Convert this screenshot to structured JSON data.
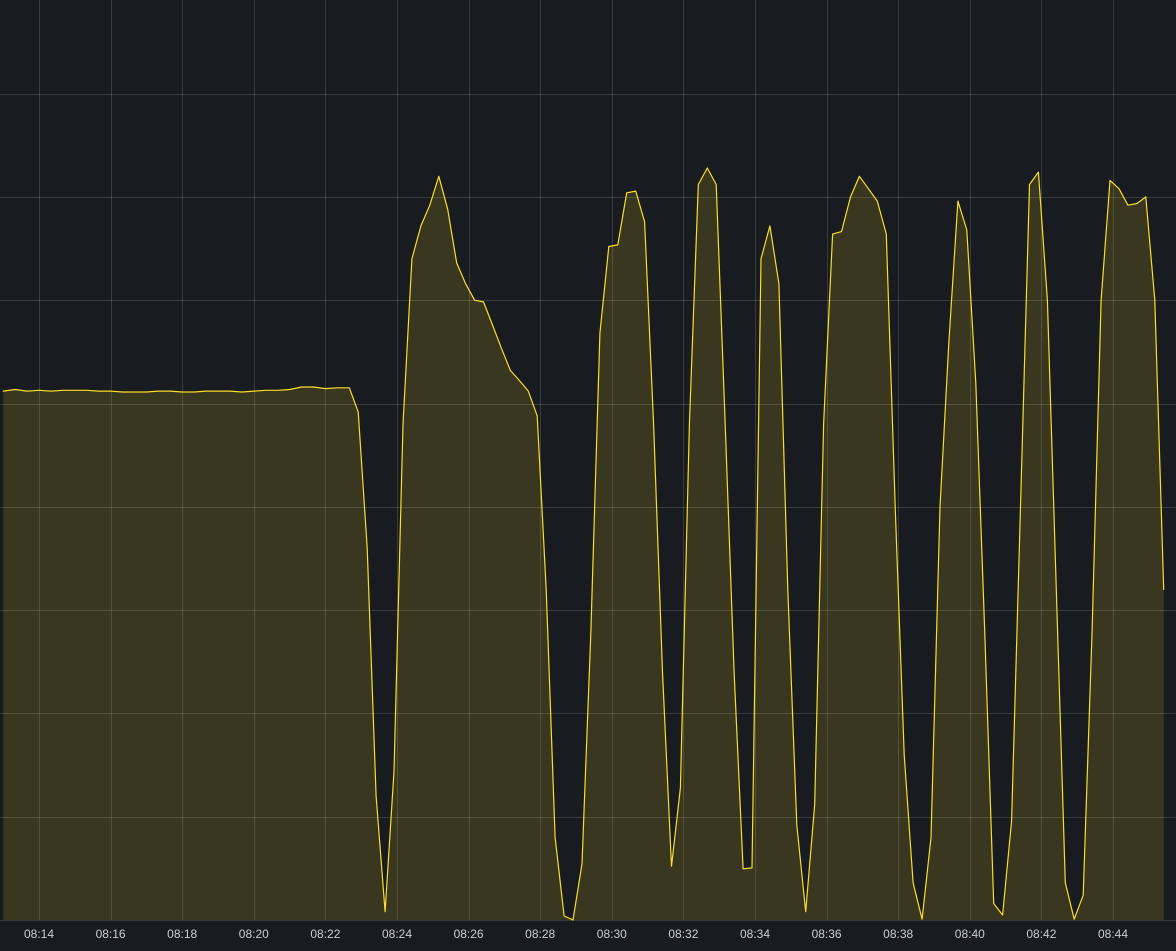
{
  "panel": {
    "background": "#181b1f",
    "series_color": "#fade2a"
  },
  "chart_data": {
    "type": "area",
    "title": "",
    "xlabel": "",
    "ylabel": "",
    "y_axis_visible": false,
    "grid": true,
    "legend": "none",
    "x_ticks": [
      "08:14",
      "08:16",
      "08:18",
      "08:20",
      "08:22",
      "08:24",
      "08:26",
      "08:28",
      "08:30",
      "08:32",
      "08:34",
      "08:36",
      "08:38",
      "08:40",
      "08:42",
      "08:44"
    ],
    "ylim": [
      0,
      100
    ],
    "series": [
      {
        "color": "#fade2a",
        "points": [
          [
            "08:13:00",
            64.0
          ],
          [
            "08:13:20",
            64.2
          ],
          [
            "08:13:40",
            64.0
          ],
          [
            "08:14:00",
            64.1
          ],
          [
            "08:14:20",
            64.0
          ],
          [
            "08:14:40",
            64.1
          ],
          [
            "08:15:00",
            64.1
          ],
          [
            "08:15:20",
            64.1
          ],
          [
            "08:15:40",
            64.0
          ],
          [
            "08:16:00",
            64.0
          ],
          [
            "08:16:20",
            63.9
          ],
          [
            "08:16:40",
            63.9
          ],
          [
            "08:17:00",
            63.9
          ],
          [
            "08:17:20",
            64.0
          ],
          [
            "08:17:40",
            64.0
          ],
          [
            "08:18:00",
            63.9
          ],
          [
            "08:18:20",
            63.9
          ],
          [
            "08:18:40",
            64.0
          ],
          [
            "08:19:00",
            64.0
          ],
          [
            "08:19:20",
            64.0
          ],
          [
            "08:19:40",
            63.9
          ],
          [
            "08:20:00",
            64.0
          ],
          [
            "08:20:20",
            64.1
          ],
          [
            "08:20:40",
            64.1
          ],
          [
            "08:21:00",
            64.2
          ],
          [
            "08:21:20",
            64.5
          ],
          [
            "08:21:40",
            64.5
          ],
          [
            "08:22:00",
            64.3
          ],
          [
            "08:22:20",
            64.4
          ],
          [
            "08:22:40",
            64.4
          ],
          [
            "08:22:55",
            61.5
          ],
          [
            "08:23:10",
            45.0
          ],
          [
            "08:23:25",
            15.0
          ],
          [
            "08:23:40",
            1.0
          ],
          [
            "08:23:55",
            18.0
          ],
          [
            "08:24:10",
            60.0
          ],
          [
            "08:24:25",
            80.0
          ],
          [
            "08:24:40",
            84.0
          ],
          [
            "08:24:55",
            86.5
          ],
          [
            "08:25:10",
            90.0
          ],
          [
            "08:25:25",
            86.0
          ],
          [
            "08:25:40",
            79.5
          ],
          [
            "08:25:55",
            77.0
          ],
          [
            "08:26:10",
            75.0
          ],
          [
            "08:26:25",
            74.8
          ],
          [
            "08:26:40",
            72.0
          ],
          [
            "08:26:55",
            69.2
          ],
          [
            "08:27:10",
            66.5
          ],
          [
            "08:27:25",
            65.3
          ],
          [
            "08:27:40",
            64.0
          ],
          [
            "08:27:55",
            61.0
          ],
          [
            "08:28:10",
            40.0
          ],
          [
            "08:28:25",
            10.0
          ],
          [
            "08:28:40",
            0.5
          ],
          [
            "08:28:55",
            0.0
          ],
          [
            "08:29:10",
            6.8
          ],
          [
            "08:29:25",
            35.0
          ],
          [
            "08:29:40",
            71.0
          ],
          [
            "08:29:55",
            81.5
          ],
          [
            "08:30:10",
            81.7
          ],
          [
            "08:30:25",
            88.0
          ],
          [
            "08:30:40",
            88.2
          ],
          [
            "08:30:55",
            84.5
          ],
          [
            "08:31:10",
            60.0
          ],
          [
            "08:31:25",
            30.0
          ],
          [
            "08:31:40",
            6.5
          ],
          [
            "08:31:55",
            16.0
          ],
          [
            "08:32:10",
            60.0
          ],
          [
            "08:32:25",
            89.0
          ],
          [
            "08:32:40",
            91.0
          ],
          [
            "08:32:55",
            89.0
          ],
          [
            "08:33:10",
            60.0
          ],
          [
            "08:33:25",
            30.0
          ],
          [
            "08:33:40",
            6.2
          ],
          [
            "08:33:55",
            6.3
          ],
          [
            "08:34:10",
            80.0
          ],
          [
            "08:34:25",
            84.0
          ],
          [
            "08:34:40",
            77.0
          ],
          [
            "08:34:55",
            40.0
          ],
          [
            "08:35:10",
            11.5
          ],
          [
            "08:35:25",
            1.0
          ],
          [
            "08:35:40",
            14.0
          ],
          [
            "08:35:55",
            60.0
          ],
          [
            "08:36:10",
            83.0
          ],
          [
            "08:36:25",
            83.3
          ],
          [
            "08:36:40",
            87.5
          ],
          [
            "08:36:55",
            90.0
          ],
          [
            "08:37:10",
            88.5
          ],
          [
            "08:37:25",
            87.0
          ],
          [
            "08:37:40",
            83.0
          ],
          [
            "08:37:55",
            50.0
          ],
          [
            "08:38:10",
            20.0
          ],
          [
            "08:38:25",
            4.5
          ],
          [
            "08:38:40",
            0.1
          ],
          [
            "08:38:55",
            10.0
          ],
          [
            "08:39:10",
            50.0
          ],
          [
            "08:39:25",
            70.0
          ],
          [
            "08:39:40",
            87.0
          ],
          [
            "08:39:55",
            83.5
          ],
          [
            "08:40:10",
            65.0
          ],
          [
            "08:40:25",
            35.0
          ],
          [
            "08:40:40",
            2.0
          ],
          [
            "08:40:55",
            0.6
          ],
          [
            "08:41:10",
            12.0
          ],
          [
            "08:41:25",
            50.0
          ],
          [
            "08:41:40",
            89.0
          ],
          [
            "08:41:55",
            90.5
          ],
          [
            "08:42:10",
            75.0
          ],
          [
            "08:42:25",
            40.0
          ],
          [
            "08:42:40",
            4.5
          ],
          [
            "08:42:55",
            0.1
          ],
          [
            "08:43:10",
            3.0
          ],
          [
            "08:43:25",
            35.0
          ],
          [
            "08:43:40",
            75.0
          ],
          [
            "08:43:55",
            89.5
          ],
          [
            "08:44:10",
            88.5
          ],
          [
            "08:44:25",
            86.5
          ],
          [
            "08:44:40",
            86.7
          ],
          [
            "08:44:55",
            87.5
          ],
          [
            "08:45:10",
            75.0
          ],
          [
            "08:45:25",
            40.0
          ]
        ]
      }
    ]
  }
}
